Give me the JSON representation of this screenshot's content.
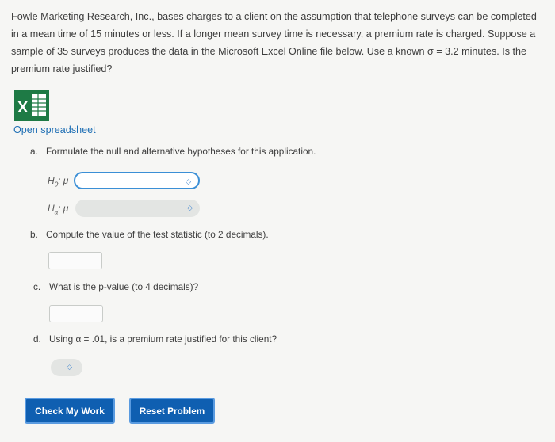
{
  "problem": {
    "text": "Fowle Marketing Research, Inc., bases charges to a client on the assumption that telephone surveys can be completed in a mean time of 15 minutes or less. If a longer mean survey time is necessary, a premium rate is charged. Suppose a sample of 35 surveys produces the data in the Microsoft Excel Online file below. Use a known σ = 3.2 minutes. Is the premium rate justified?"
  },
  "spreadsheet": {
    "link_label": "Open spreadsheet",
    "icon": "excel-icon"
  },
  "questions": {
    "a": {
      "letter": "a.",
      "text": "Formulate the null and alternative hypotheses for this application."
    },
    "h0": {
      "label": "H",
      "sub": "0",
      "suffix": ": μ",
      "selected": ""
    },
    "ha": {
      "label": "H",
      "sub": "a",
      "suffix": ": μ",
      "selected": ""
    },
    "b": {
      "letter": "b.",
      "text": "Compute the value of the test statistic (to 2 decimals).",
      "value": ""
    },
    "c": {
      "letter": "c.",
      "text": "What is the p-value (to 4 decimals)?",
      "value": ""
    },
    "d": {
      "letter": "d.",
      "text": "Using α = .01, is a premium rate justified for this client?",
      "selected": ""
    }
  },
  "buttons": {
    "check": "Check My Work",
    "reset": "Reset Problem"
  },
  "colors": {
    "accent": "#0f5fb1",
    "link": "#1f6fb4",
    "excel_green": "#1e7a45"
  }
}
